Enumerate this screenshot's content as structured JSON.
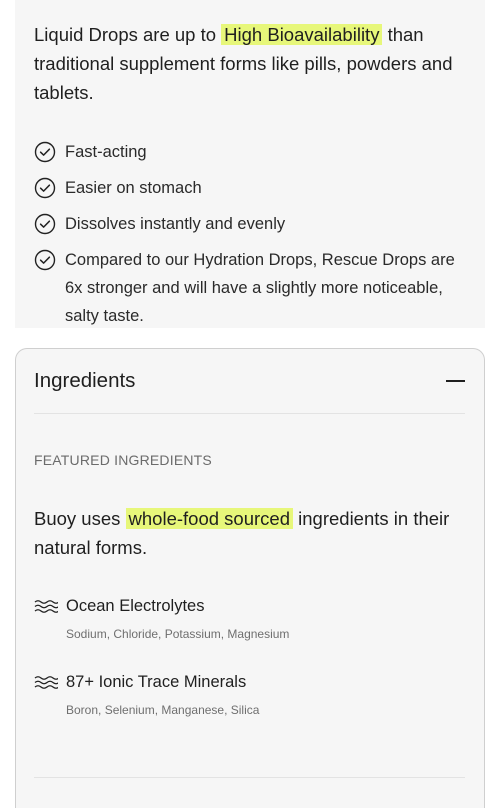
{
  "intro": {
    "before": "Liquid Drops are up to",
    "highlight": "High Bioavailability",
    "after": "than traditional supplement forms like pills, powders and tablets."
  },
  "benefits": [
    "Fast-acting",
    "Easier on stomach",
    "Dissolves instantly and evenly",
    "Compared to our Hydration Drops, Rescue Drops are 6x stronger and will have a slightly more noticeable, salty taste."
  ],
  "accordion": {
    "title": "Ingredients",
    "expanded": true,
    "section_label": "FEATURED INGREDIENTS",
    "lead_before": "Buoy uses",
    "lead_highlight": "whole-food sourced",
    "lead_after": "ingredients in their natural forms.",
    "ingredients": [
      {
        "name": "Ocean Electrolytes",
        "detail": "Sodium, Chloride, Potassium, Magnesium",
        "icon": "waves-icon"
      },
      {
        "name": "87+ Ionic Trace Minerals",
        "detail": "Boron, Selenium, Manganese, Silica",
        "icon": "waves-icon"
      }
    ]
  },
  "colors": {
    "highlight": "#e7f77a",
    "card_bg": "#f6f6f6",
    "text": "#1f1f1f",
    "muted": "#6b6b6b"
  }
}
